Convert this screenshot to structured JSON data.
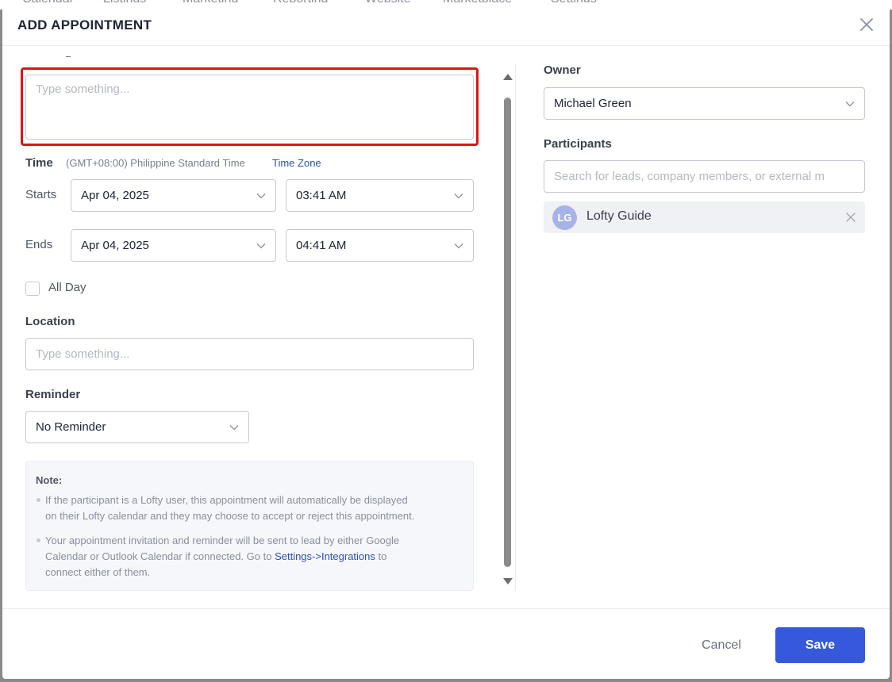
{
  "background_nav": [
    "Calendar",
    "Listings",
    "Marketing",
    "Reporting",
    "Website",
    "Marketplace",
    "Settings"
  ],
  "modal": {
    "title": "ADD APPOINTMENT",
    "close_icon": "close-icon"
  },
  "description": {
    "placeholder": "Type something..."
  },
  "time": {
    "label": "Time",
    "timezone_text": "(GMT+08:00) Philippine Standard Time",
    "timezone_link": "Time Zone",
    "starts_label": "Starts",
    "start_date": "Apr 04, 2025",
    "start_time": "03:41 AM",
    "ends_label": "Ends",
    "end_date": "Apr 04, 2025",
    "end_time": "04:41 AM"
  },
  "all_day": {
    "label": "All Day",
    "checked": false
  },
  "location": {
    "label": "Location",
    "placeholder": "Type something..."
  },
  "reminder": {
    "label": "Reminder",
    "value": "No Reminder"
  },
  "note": {
    "title": "Note:",
    "item1_line1": "If the participant is a Lofty user, this appointment will automatically be displayed",
    "item1_line2": "on their Lofty calendar and they may choose to accept or reject this appointment.",
    "item2_line1": "Your appointment invitation and reminder will be sent to lead by either Google",
    "item2_line2_pre": "Calendar or Outlook Calendar if connected. Go to ",
    "item2_link": "Settings->Integrations",
    "item2_line2_post": " to",
    "item2_line3": "connect either of them."
  },
  "owner": {
    "label": "Owner",
    "value": "Michael Green"
  },
  "participants": {
    "label": "Participants",
    "placeholder": "Search for leads, company members, or external m",
    "items": [
      {
        "initials": "LG",
        "name": "Lofty Guide"
      }
    ]
  },
  "footer": {
    "cancel_label": "Cancel",
    "save_label": "Save"
  },
  "colors": {
    "accent": "#3558dd",
    "highlight": "#e01414",
    "link": "#2a50b6"
  }
}
